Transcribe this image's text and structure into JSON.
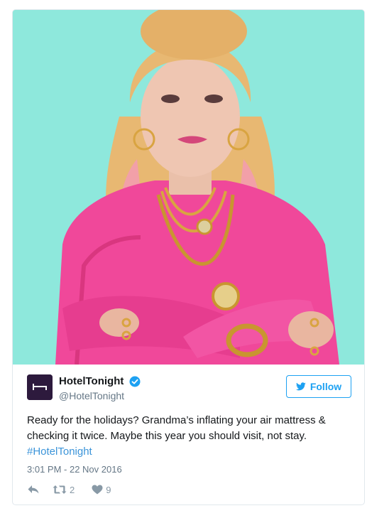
{
  "tweet": {
    "display_name": "HotelTonight",
    "handle": "@HotelTonight",
    "follow_label": "Follow",
    "text_before_hashtag": "Ready for the holidays? Grandma’s inflating your air mattress & checking it twice. Maybe this year you should visit, not stay.",
    "hashtag": "#HotelTonight",
    "timestamp": "3:01 PM - 22 Nov 2016",
    "retweet_count": "2",
    "like_count": "9"
  },
  "colors": {
    "accent": "#1da1f2",
    "hashtag": "#3b94d9",
    "media_background": "#8ee8dc",
    "avatar_background": "#2d1a3d",
    "sweater": "#f0489a"
  },
  "icons": {
    "avatar": "bed-icon",
    "verified": "verified-badge-icon",
    "follow": "twitter-bird-icon",
    "reply": "reply-icon",
    "retweet": "retweet-icon",
    "like": "heart-icon"
  }
}
